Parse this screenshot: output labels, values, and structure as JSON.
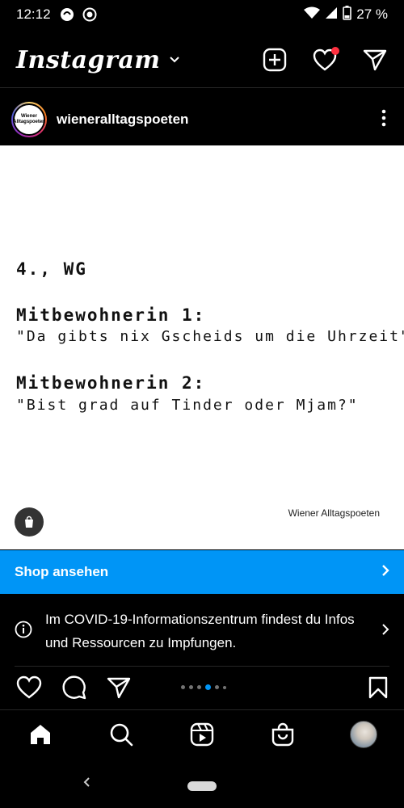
{
  "status": {
    "time": "12:12",
    "battery": "27 %"
  },
  "header": {
    "logo": "Instagram"
  },
  "post": {
    "username": "wieneralltagspoeten",
    "avatar_text": "Wiener Alltagspoeten",
    "lines": [
      "4., WG",
      "Mitbewohnerin 1:",
      "\"Da gibts nix Gscheids um die Uhrzeit\"",
      "Mitbewohnerin 2:",
      "\"Bist grad auf Tinder oder Mjam?\""
    ],
    "credit": "Wiener Alltagspoeten"
  },
  "shop": {
    "label": "Shop ansehen"
  },
  "covid": {
    "text": "Im COVID-19-Informationszentrum findest du Infos und Ressourcen zu Impfungen."
  },
  "carousel": {
    "count": 5,
    "active_index": 3
  },
  "colors": {
    "accent": "#0095f6",
    "notification": "#ff3040",
    "background": "#000000"
  }
}
